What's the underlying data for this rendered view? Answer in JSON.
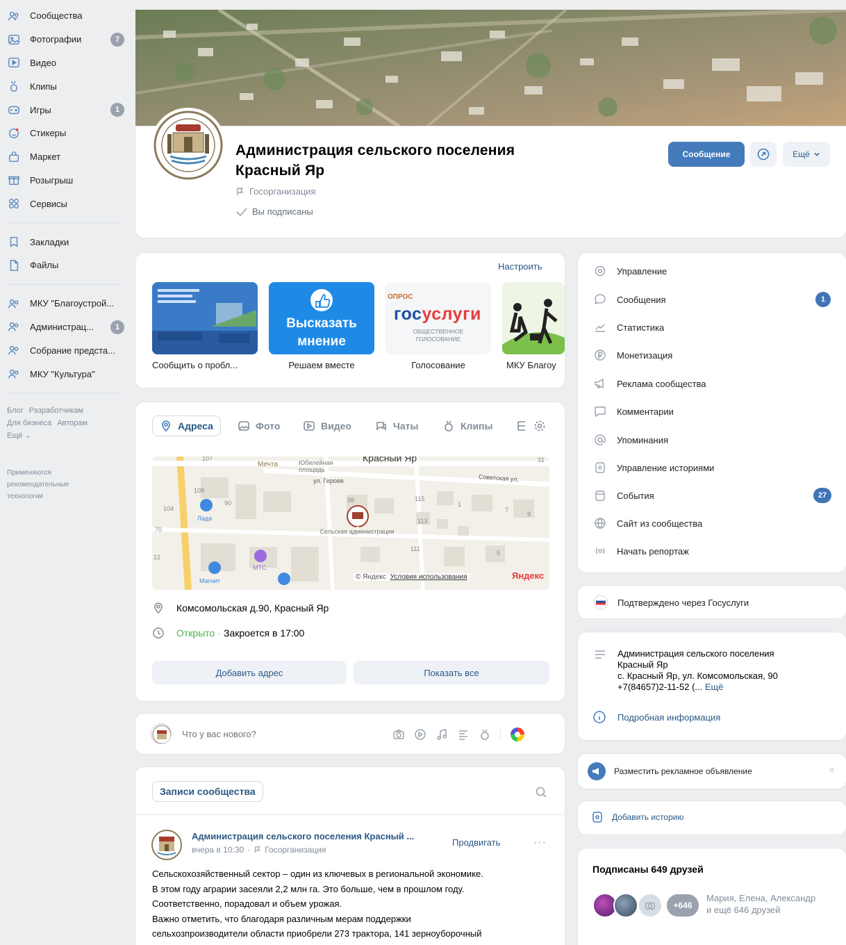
{
  "sidebar": {
    "items": [
      {
        "label": "Сообщества",
        "icon": "communities-icon",
        "count": ""
      },
      {
        "label": "Фотографии",
        "icon": "photos-icon",
        "count": "7"
      },
      {
        "label": "Видео",
        "icon": "video-icon",
        "count": ""
      },
      {
        "label": "Клипы",
        "icon": "clips-icon",
        "count": ""
      },
      {
        "label": "Игры",
        "icon": "games-icon",
        "count": "1"
      },
      {
        "label": "Стикеры",
        "icon": "stickers-icon",
        "count": ""
      },
      {
        "label": "Маркет",
        "icon": "market-icon",
        "count": ""
      },
      {
        "label": "Розыгрыш",
        "icon": "giveaway-icon",
        "count": ""
      },
      {
        "label": "Сервисы",
        "icon": "services-icon",
        "count": ""
      }
    ],
    "items2": [
      {
        "label": "Закладки",
        "icon": "bookmarks-icon"
      },
      {
        "label": "Файлы",
        "icon": "files-icon"
      }
    ],
    "groups": [
      {
        "label": "МКУ \"Благоустрой...",
        "count": ""
      },
      {
        "label": "Администрац...",
        "count": "1"
      },
      {
        "label": "Собрание предста...",
        "count": ""
      },
      {
        "label": "МКУ \"Культура\"",
        "count": ""
      }
    ],
    "footer": {
      "blog": "Блог",
      "dev": "Разработчикам",
      "business": "Для бизнеса",
      "authors": "Авторам",
      "more": "Ещё ⌄"
    },
    "note": "Применяются рекомендательные технологии"
  },
  "group": {
    "title": "Администрация сельского поселения Красный Яр",
    "type": "Госорганизация",
    "subscribed": "Вы подписаны",
    "message_btn": "Сообщение",
    "more_btn": "Ещё"
  },
  "widgets": {
    "configure": "Настроить",
    "tiles": [
      {
        "caption": "Сообщить о пробл...",
        "text": ""
      },
      {
        "caption": "Решаем вместе",
        "text": "Высказать мнение"
      },
      {
        "caption": "Голосование",
        "text": "госуслуги",
        "sub1": "ОПРОС",
        "sub2": "ОБЩЕСТВЕННОЕ ГОЛОСОВАНИЕ"
      },
      {
        "caption": "МКУ Благоу",
        "text": ""
      }
    ]
  },
  "tabs": [
    {
      "label": "Адреса"
    },
    {
      "label": "Фото"
    },
    {
      "label": "Видео"
    },
    {
      "label": "Чаты"
    },
    {
      "label": "Клипы"
    }
  ],
  "map": {
    "labels": {
      "city": "Красный Яр",
      "street1": "ул. Героев",
      "street2": "Советская ул.",
      "square": "Юбилейная площадь",
      "mechta": "Мечта",
      "lada": "Лада",
      "mts": "МТС",
      "magnit": "Магнит",
      "admin": "Сельская администрация",
      "copyright": "© Яндекс",
      "terms": "Условия использования",
      "yandex": "Яндекс"
    },
    "numbers": [
      "107",
      "108",
      "104",
      "90",
      "98",
      "115",
      "113",
      "111",
      "70",
      "12",
      "1",
      "7",
      "9",
      "5",
      "31"
    ]
  },
  "address": {
    "text": "Комсомольская д.90, Красный Яр",
    "open": "Открыто",
    "closes": "Закроется в 17:00",
    "add_btn": "Добавить адрес",
    "show_btn": "Показать все"
  },
  "composer": {
    "placeholder": "Что у вас нового?"
  },
  "wall": {
    "filter": "Записи сообщества"
  },
  "post": {
    "author": "Администрация сельского поселения Красный ...",
    "time": "вчера в 10:30",
    "type": "Госорганизация",
    "promote": "Продвигать",
    "text": [
      "Сельскохозяйственный сектор – один из ключевых в региональной экономике.",
      "В этом году аграрии засеяли 2,2 млн га. Это больше, чем в прошлом году.",
      "Соответственно, порадовал и объем урожая.",
      "Важно отметить, что благодаря различным мерам поддержки",
      "сельхозпроизводители области приобрели 273 трактора, 141 зерноуборочный"
    ]
  },
  "manage_menu": [
    {
      "label": "Управление",
      "icon": "gear-icon",
      "badge": ""
    },
    {
      "label": "Сообщения",
      "icon": "message-icon",
      "badge": "1"
    },
    {
      "label": "Статистика",
      "icon": "stats-icon",
      "badge": ""
    },
    {
      "label": "Монетизация",
      "icon": "money-icon",
      "badge": ""
    },
    {
      "label": "Реклама сообщества",
      "icon": "megaphone-icon",
      "badge": ""
    },
    {
      "label": "Комментарии",
      "icon": "comment-icon",
      "badge": ""
    },
    {
      "label": "Упоминания",
      "icon": "mention-icon",
      "badge": ""
    },
    {
      "label": "Управление историями",
      "icon": "stories-icon",
      "badge": ""
    },
    {
      "label": "События",
      "icon": "events-icon",
      "badge": "27"
    },
    {
      "label": "Сайт из сообщества",
      "icon": "globe-icon",
      "badge": ""
    },
    {
      "label": "Начать репортаж",
      "icon": "broadcast-icon",
      "badge": ""
    }
  ],
  "verified": "Подтверждено через Госуслуги",
  "about": {
    "line1": "Администрация сельского поселения",
    "line2": "Красный Яр",
    "line3": "с. Красный Яр, ул. Комсомольская, 90",
    "line4": "+7(84657)2-11-52 (...",
    "more": "Ещё",
    "details": "Подробная информация"
  },
  "ads": {
    "label": "Разместить рекламное объявление"
  },
  "stories": {
    "label": "Добавить историю"
  },
  "friends": {
    "title": "Подписаны 649 друзей",
    "extra": "+646",
    "names": "Мария, Елена, Александр",
    "more": "и ещё 646 друзей"
  },
  "colors": {
    "accent": "#447bba",
    "link": "#2a5885",
    "green": "#4bb34b",
    "badge": "#3f74b5"
  }
}
